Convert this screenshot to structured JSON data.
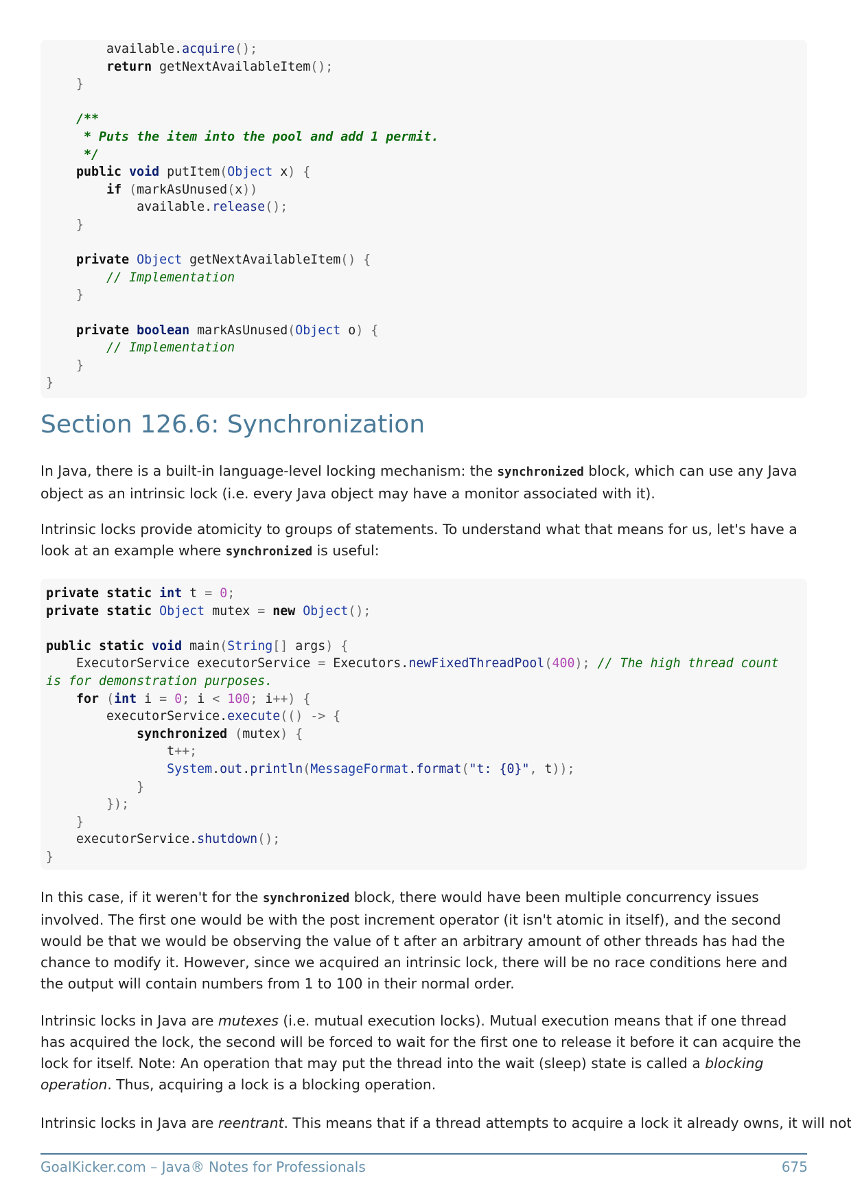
{
  "code_block_1": [
    "        available.acquire();",
    "        return getNextAvailableItem();",
    "    }",
    "",
    "    /**",
    "     * Puts the item into the pool and add 1 permit.",
    "     */",
    "    public void putItem(Object x) {",
    "        if (markAsUnused(x))",
    "            available.release();",
    "    }",
    "",
    "    private Object getNextAvailableItem() {",
    "        // Implementation",
    "    }",
    "",
    "    private boolean markAsUnused(Object o) {",
    "        // Implementation",
    "    }",
    "}"
  ],
  "section_title": "Section 126.6: Synchronization",
  "paragraph_1": {
    "before": "In Java, there is a built-in language-level locking mechanism: the ",
    "code": "synchronized",
    "after": " block, which can use any Java object as an intrinsic lock (i.e. every Java object may have a monitor associated with it)."
  },
  "paragraph_2": {
    "before": "Intrinsic locks provide atomicity to groups of statements. To understand what that means for us, let's have a look at an example where ",
    "code": "synchronized",
    "after": " is useful:"
  },
  "code_block_2": [
    "private static int t = 0;",
    "private static Object mutex = new Object();",
    "",
    "public static void main(String[] args) {",
    "    ExecutorService executorService = Executors.newFixedThreadPool(400); // The high thread count",
    "is for demonstration purposes.",
    "    for (int i = 0; i < 100; i++) {",
    "        executorService.execute(() -> {",
    "            synchronized (mutex) {",
    "                t++;",
    "                System.out.println(MessageFormat.format(\"t: {0}\", t));",
    "            }",
    "        });",
    "    }",
    "    executorService.shutdown();",
    "}"
  ],
  "paragraph_3": {
    "before": "In this case, if it weren't for the ",
    "code": "synchronized",
    "after": " block, there would have been multiple concurrency issues involved. The first one would be with the post increment operator (it isn't atomic in itself), and the second would be that we would be observing the value of t after an arbitrary amount of other threads has had the chance to modify it. However, since we acquired an intrinsic lock, there will be no race conditions here and the output will contain numbers from 1 to 100 in their normal order."
  },
  "paragraph_4": {
    "t1": "Intrinsic locks in Java are ",
    "em1": "mutexes",
    "t2": " (i.e. mutual execution locks). Mutual execution means that if one thread has acquired the lock, the second will be forced to wait for the first one to release it before it can acquire the lock for itself. Note: An operation that may put the thread into the wait (sleep) state is called a ",
    "em2": "blocking operation",
    "t3": ". Thus, acquiring a lock is a blocking operation."
  },
  "paragraph_5": {
    "t1": "Intrinsic locks in Java are ",
    "em1": "reentrant",
    "t2": ". This means that if a thread attempts to acquire a lock it already owns, it will not"
  },
  "footer": {
    "left": "GoalKicker.com – Java® Notes for Professionals",
    "page_number": "675"
  },
  "colors": {
    "heading": "#4a7a98",
    "footer": "#6a93ad",
    "code_background": "#f7f7f7",
    "comment": "#0c6b0c",
    "number": "#b04ab4"
  }
}
